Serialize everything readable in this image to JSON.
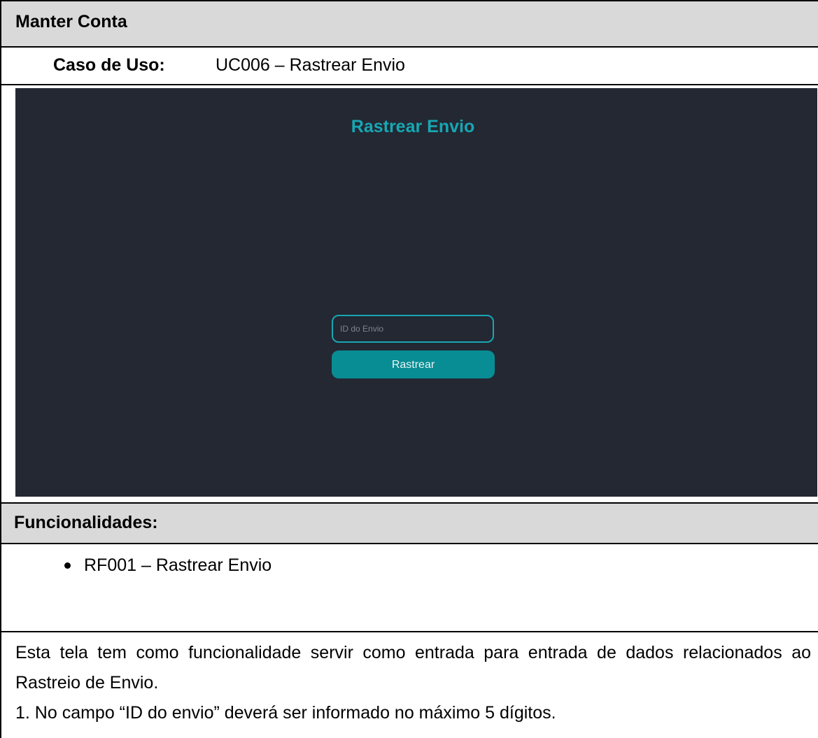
{
  "header": {
    "title": "Manter Conta"
  },
  "use_case": {
    "label": "Caso de Uso:",
    "value": "UC006 – Rastrear Envio"
  },
  "screen": {
    "title": "Rastrear Envio",
    "id_input": {
      "placeholder": "ID do Envio",
      "value": ""
    },
    "track_button_label": "Rastrear",
    "colors": {
      "background": "#232833",
      "accent": "#17a7b3",
      "button": "#088d94"
    }
  },
  "functionalities": {
    "title": "Funcionalidades:",
    "items": [
      {
        "label": "RF001 – Rastrear Envio"
      }
    ]
  },
  "description": {
    "paragraph": "Esta tela tem como funcionalidade servir como entrada para entrada de dados relacionados ao Rastreio de Envio.",
    "rule_1": "1. No campo “ID do envio” deverá ser informado no máximo 5 dígitos."
  }
}
